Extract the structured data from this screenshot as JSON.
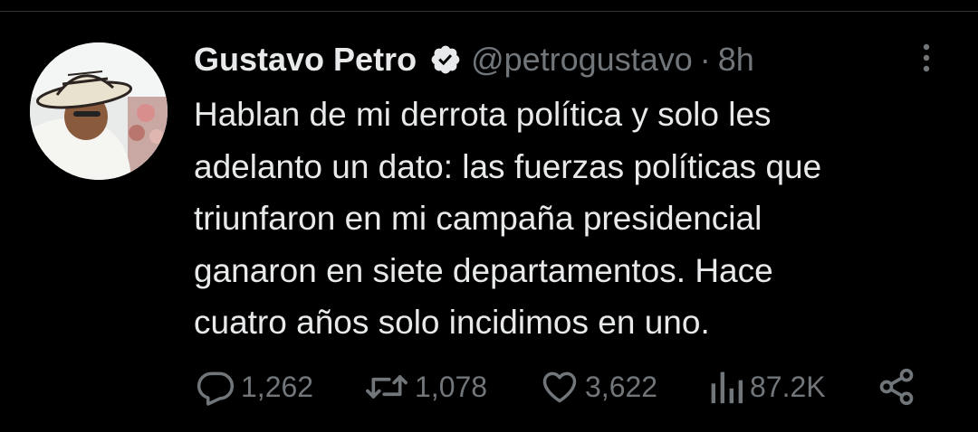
{
  "tweet": {
    "author_name": "Gustavo Petro",
    "handle": "@petrogustavo",
    "separator": "·",
    "time": "8h",
    "text": "Hablan de mi derrota política y solo les\nadelanto un dato: las fuerzas políticas que\ntriunfaron en mi campaña presidencial\nganaron en siete departamentos. Hace\ncuatro años solo incidimos en uno."
  },
  "actions": {
    "replies": "1,262",
    "retweets": "1,078",
    "likes": "3,622",
    "views": "87.2K"
  },
  "icons": {
    "verified": "verified-badge-icon",
    "more": "more-vertical-icon",
    "reply": "reply-icon",
    "retweet": "retweet-icon",
    "like": "heart-icon",
    "views": "views-chart-icon",
    "share": "share-icon"
  },
  "colors": {
    "background": "#000000",
    "text_primary": "#e7e9ea",
    "text_secondary": "#71767b",
    "verified_badge": "#e7e9ea"
  }
}
